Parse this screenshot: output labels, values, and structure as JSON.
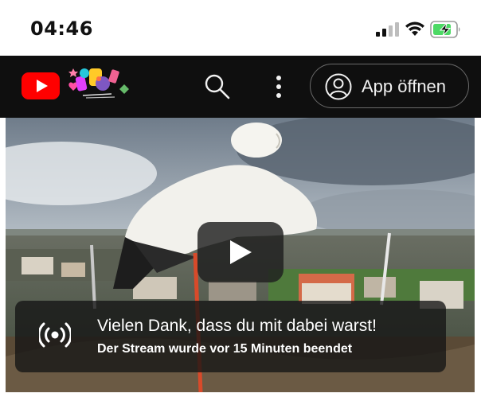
{
  "status_bar": {
    "time": "04:46",
    "icons": [
      "cellular-signal-icon",
      "wifi-icon",
      "battery-charging-icon"
    ],
    "battery_color": "#4cd964"
  },
  "header": {
    "logo": "youtube-logo",
    "doodle": "youtube-doodle",
    "search_icon": "search-icon",
    "menu_icon": "more-vert-icon",
    "app_button_label": "App öffnen",
    "accent_color": "#ff0000",
    "background": "#0f0f0f"
  },
  "video": {
    "play_icon": "play-icon",
    "ended_card": {
      "icon": "live-broadcast-icon",
      "title": "Vielen Dank, dass du mit dabei warst!",
      "subtitle": "Der Stream wurde vor 15 Minuten beendet"
    }
  }
}
